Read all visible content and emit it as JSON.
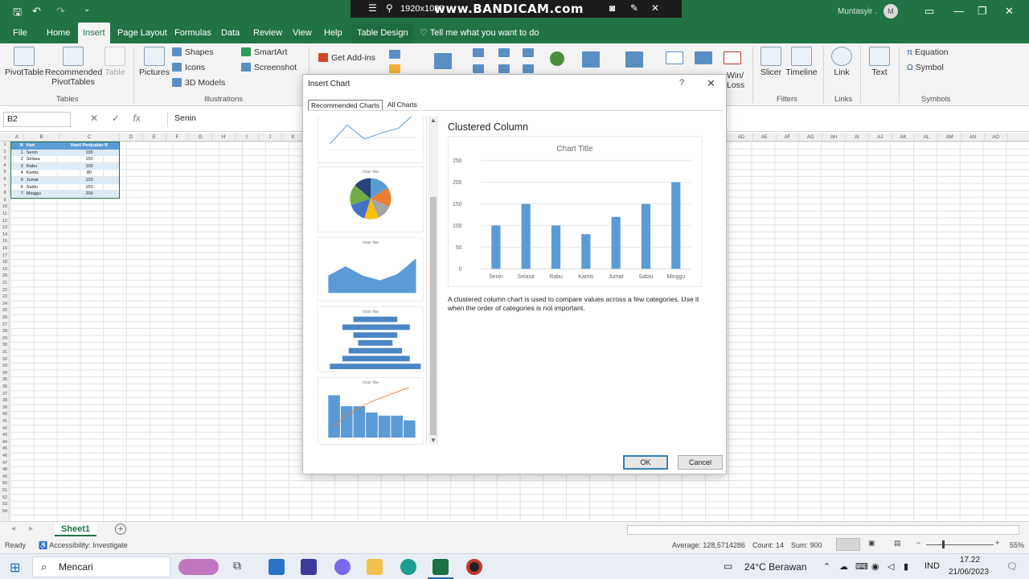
{
  "titlebar": {
    "recorder_resolution": "1920x1080",
    "recorder_brand": "www.BANDICAM.com",
    "user_name": "Muntasyir .",
    "avatar_initial": "M"
  },
  "menu_tabs": [
    "File",
    "Home",
    "Insert",
    "Page Layout",
    "Formulas",
    "Data",
    "Review",
    "View",
    "Help",
    "Table Design"
  ],
  "active_tab": "Insert",
  "tell_me": "Tell me what you want to do",
  "ribbon": {
    "pivottable": "PivotTable",
    "recommended_pivot": "Recommended PivotTables",
    "table": "Table",
    "tables_group": "Tables",
    "pictures": "Pictures",
    "shapes": "Shapes",
    "icons": "Icons",
    "models": "3D Models",
    "smartart": "SmartArt",
    "screenshot": "Screenshot",
    "illustrations_group": "Illustrations",
    "get_addins": "Get Add-ins",
    "winloss": "Win/\nLoss",
    "slicer": "Slicer",
    "timeline": "Timeline",
    "filters_group": "Filters",
    "link": "Link",
    "links_group": "Links",
    "text": "Text",
    "equation": "Equation",
    "symbol": "Symbol",
    "symbols_group": "Symbols"
  },
  "formula_bar": {
    "name_box": "B2",
    "fx": "fx",
    "value": "Senin"
  },
  "sheet": {
    "columns": [
      "A",
      "B",
      "C",
      "D",
      "E",
      "F",
      "G",
      "H",
      "I",
      "J",
      "K",
      "AD",
      "AE",
      "AF",
      "AG",
      "AH",
      "AI",
      "AJ",
      "AK",
      "AL",
      "AM",
      "AN",
      "AO"
    ],
    "table_headers": [
      "N",
      "Hari",
      "Hasil Penjualan R"
    ],
    "rows": [
      {
        "n": "1",
        "hari": "Senin",
        "val": "100"
      },
      {
        "n": "2",
        "hari": "Selasa",
        "val": "150"
      },
      {
        "n": "3",
        "hari": "Rabu",
        "val": "100"
      },
      {
        "n": "4",
        "hari": "Kamis",
        "val": "80"
      },
      {
        "n": "5",
        "hari": "Jumat",
        "val": "120"
      },
      {
        "n": "6",
        "hari": "Sabtu",
        "val": "150"
      },
      {
        "n": "7",
        "hari": "Minggu",
        "val": "200"
      }
    ],
    "tab_name": "Sheet1"
  },
  "status": {
    "ready": "Ready",
    "accessibility": "Accessibility: Investigate",
    "average": "Average: 128,5714286",
    "count": "Count: 14",
    "sum": "Sum: 900",
    "zoom": "55%"
  },
  "taskbar": {
    "search": "Mencari",
    "weather": "24°C  Berawan",
    "lang": "IND",
    "time": "17.22",
    "date": "21/06/2023"
  },
  "dialog": {
    "title": "Insert Chart",
    "help": "?",
    "close": "✕",
    "tab_recommended": "Recommended Charts",
    "tab_all": "All Charts",
    "preview_name": "Clustered Column",
    "description": "A clustered column chart is used to compare values across a few categories. Use it when the order of categories is not important.",
    "ok": "OK",
    "cancel": "Cancel",
    "thumb_title": "Chart Title"
  },
  "chart_data": {
    "type": "bar",
    "title": "Chart Title",
    "categories": [
      "Senin",
      "Selasa",
      "Rabu",
      "Kamis",
      "Jumat",
      "Sabtu",
      "Minggu"
    ],
    "values": [
      100,
      150,
      100,
      80,
      120,
      150,
      200
    ],
    "yticks": [
      0,
      50,
      100,
      150,
      200,
      250
    ],
    "ylim": [
      0,
      250
    ],
    "grid": true,
    "color": "#5b9bd5"
  },
  "colors": {
    "excel_green": "#217346",
    "accent_blue": "#5b9bd5"
  }
}
